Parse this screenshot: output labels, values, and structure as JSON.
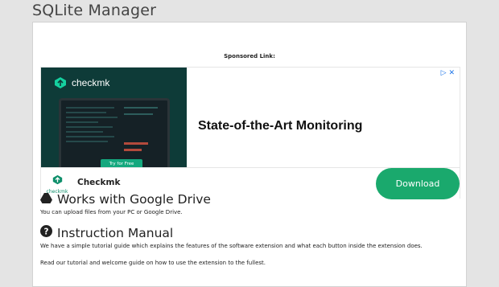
{
  "app": {
    "title": "SQLite Manager"
  },
  "sponsored_label": "Sponsored Link:",
  "ad": {
    "brand_logo_text": "checkmk",
    "image_button": "Try for Free",
    "badge": "▷ ✕",
    "headline": "State-of-the-Art Monitoring",
    "advertiser_logo_text": "checkmk",
    "advertiser": "Checkmk",
    "cta": "Download",
    "colors": {
      "brand_dark": "#0e3b38",
      "cta_green": "#1aa96d"
    }
  },
  "sections": [
    {
      "icon": "google-drive-icon",
      "title": "Works with Google Drive",
      "paragraphs": [
        "You can upload files from your PC or Google Drive."
      ]
    },
    {
      "icon": "question-circle-icon",
      "title": "Instruction Manual",
      "paragraphs": [
        "We have a simple tutorial guide which explains the features of the software extension and what each button inside the extension does.",
        "Read our tutorial and welcome guide on how to use the extension to the fullest."
      ]
    }
  ]
}
